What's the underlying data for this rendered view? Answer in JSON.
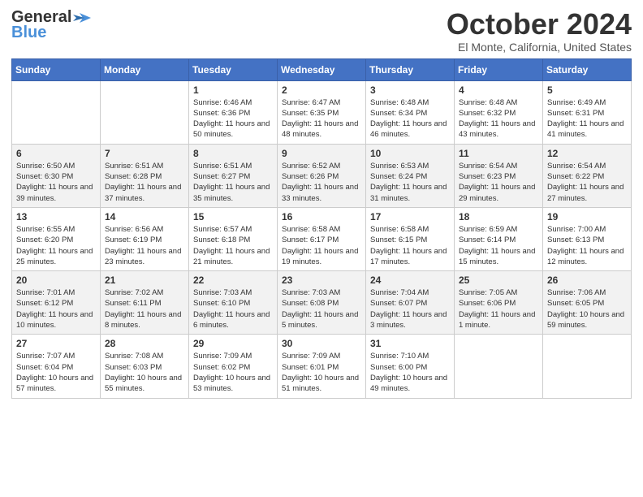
{
  "logo": {
    "line1": "General",
    "line2": "Blue"
  },
  "header": {
    "month": "October 2024",
    "location": "El Monte, California, United States"
  },
  "weekdays": [
    "Sunday",
    "Monday",
    "Tuesday",
    "Wednesday",
    "Thursday",
    "Friday",
    "Saturday"
  ],
  "weeks": [
    [
      {
        "day": "",
        "info": ""
      },
      {
        "day": "",
        "info": ""
      },
      {
        "day": "1",
        "info": "Sunrise: 6:46 AM\nSunset: 6:36 PM\nDaylight: 11 hours and 50 minutes."
      },
      {
        "day": "2",
        "info": "Sunrise: 6:47 AM\nSunset: 6:35 PM\nDaylight: 11 hours and 48 minutes."
      },
      {
        "day": "3",
        "info": "Sunrise: 6:48 AM\nSunset: 6:34 PM\nDaylight: 11 hours and 46 minutes."
      },
      {
        "day": "4",
        "info": "Sunrise: 6:48 AM\nSunset: 6:32 PM\nDaylight: 11 hours and 43 minutes."
      },
      {
        "day": "5",
        "info": "Sunrise: 6:49 AM\nSunset: 6:31 PM\nDaylight: 11 hours and 41 minutes."
      }
    ],
    [
      {
        "day": "6",
        "info": "Sunrise: 6:50 AM\nSunset: 6:30 PM\nDaylight: 11 hours and 39 minutes."
      },
      {
        "day": "7",
        "info": "Sunrise: 6:51 AM\nSunset: 6:28 PM\nDaylight: 11 hours and 37 minutes."
      },
      {
        "day": "8",
        "info": "Sunrise: 6:51 AM\nSunset: 6:27 PM\nDaylight: 11 hours and 35 minutes."
      },
      {
        "day": "9",
        "info": "Sunrise: 6:52 AM\nSunset: 6:26 PM\nDaylight: 11 hours and 33 minutes."
      },
      {
        "day": "10",
        "info": "Sunrise: 6:53 AM\nSunset: 6:24 PM\nDaylight: 11 hours and 31 minutes."
      },
      {
        "day": "11",
        "info": "Sunrise: 6:54 AM\nSunset: 6:23 PM\nDaylight: 11 hours and 29 minutes."
      },
      {
        "day": "12",
        "info": "Sunrise: 6:54 AM\nSunset: 6:22 PM\nDaylight: 11 hours and 27 minutes."
      }
    ],
    [
      {
        "day": "13",
        "info": "Sunrise: 6:55 AM\nSunset: 6:20 PM\nDaylight: 11 hours and 25 minutes."
      },
      {
        "day": "14",
        "info": "Sunrise: 6:56 AM\nSunset: 6:19 PM\nDaylight: 11 hours and 23 minutes."
      },
      {
        "day": "15",
        "info": "Sunrise: 6:57 AM\nSunset: 6:18 PM\nDaylight: 11 hours and 21 minutes."
      },
      {
        "day": "16",
        "info": "Sunrise: 6:58 AM\nSunset: 6:17 PM\nDaylight: 11 hours and 19 minutes."
      },
      {
        "day": "17",
        "info": "Sunrise: 6:58 AM\nSunset: 6:15 PM\nDaylight: 11 hours and 17 minutes."
      },
      {
        "day": "18",
        "info": "Sunrise: 6:59 AM\nSunset: 6:14 PM\nDaylight: 11 hours and 15 minutes."
      },
      {
        "day": "19",
        "info": "Sunrise: 7:00 AM\nSunset: 6:13 PM\nDaylight: 11 hours and 12 minutes."
      }
    ],
    [
      {
        "day": "20",
        "info": "Sunrise: 7:01 AM\nSunset: 6:12 PM\nDaylight: 11 hours and 10 minutes."
      },
      {
        "day": "21",
        "info": "Sunrise: 7:02 AM\nSunset: 6:11 PM\nDaylight: 11 hours and 8 minutes."
      },
      {
        "day": "22",
        "info": "Sunrise: 7:03 AM\nSunset: 6:10 PM\nDaylight: 11 hours and 6 minutes."
      },
      {
        "day": "23",
        "info": "Sunrise: 7:03 AM\nSunset: 6:08 PM\nDaylight: 11 hours and 5 minutes."
      },
      {
        "day": "24",
        "info": "Sunrise: 7:04 AM\nSunset: 6:07 PM\nDaylight: 11 hours and 3 minutes."
      },
      {
        "day": "25",
        "info": "Sunrise: 7:05 AM\nSunset: 6:06 PM\nDaylight: 11 hours and 1 minute."
      },
      {
        "day": "26",
        "info": "Sunrise: 7:06 AM\nSunset: 6:05 PM\nDaylight: 10 hours and 59 minutes."
      }
    ],
    [
      {
        "day": "27",
        "info": "Sunrise: 7:07 AM\nSunset: 6:04 PM\nDaylight: 10 hours and 57 minutes."
      },
      {
        "day": "28",
        "info": "Sunrise: 7:08 AM\nSunset: 6:03 PM\nDaylight: 10 hours and 55 minutes."
      },
      {
        "day": "29",
        "info": "Sunrise: 7:09 AM\nSunset: 6:02 PM\nDaylight: 10 hours and 53 minutes."
      },
      {
        "day": "30",
        "info": "Sunrise: 7:09 AM\nSunset: 6:01 PM\nDaylight: 10 hours and 51 minutes."
      },
      {
        "day": "31",
        "info": "Sunrise: 7:10 AM\nSunset: 6:00 PM\nDaylight: 10 hours and 49 minutes."
      },
      {
        "day": "",
        "info": ""
      },
      {
        "day": "",
        "info": ""
      }
    ]
  ]
}
